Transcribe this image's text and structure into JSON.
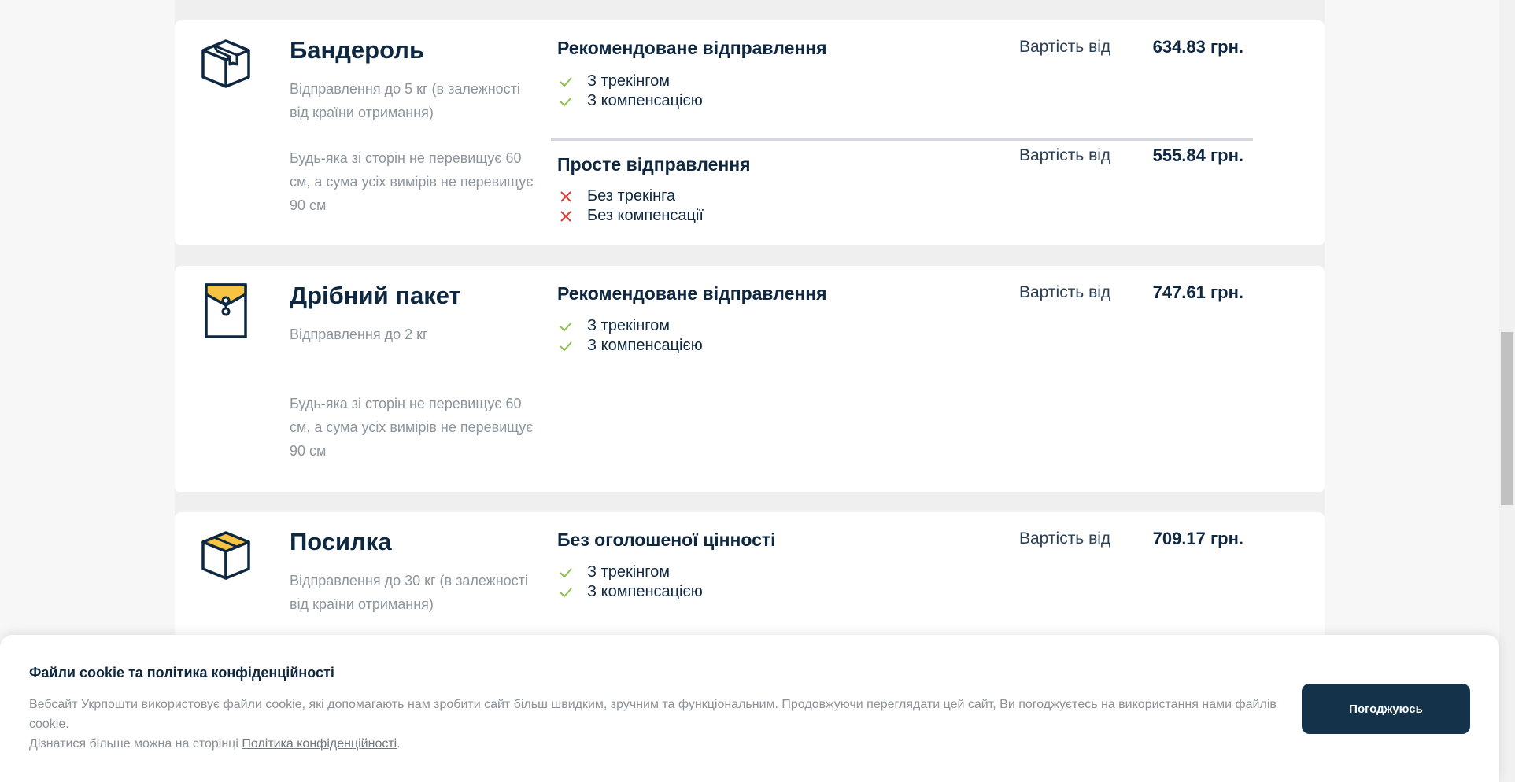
{
  "colors": {
    "brand_dark": "#0f2841",
    "accent_yellow": "#f6c343",
    "check_green": "#8bc34a",
    "cross_red": "#e53935",
    "button_bg": "#143249"
  },
  "cards": [
    {
      "icon": "box-icon",
      "title": "Бандероль",
      "desc1": "Відправлення до 5 кг (в залежності від країни отримання)",
      "desc2": "Будь-яка зі сторін не перевищує 60 см, а сума усіх вимірів не перевищує 90 см",
      "options": [
        {
          "title": "Рекомендоване відправлення",
          "features": [
            {
              "icon": "check-icon",
              "text": "З трекінгом"
            },
            {
              "icon": "check-icon",
              "text": "З компенсацією"
            }
          ],
          "price_label": "Вартість від",
          "price": "634.83 грн."
        },
        {
          "title": "Просте відправлення",
          "features": [
            {
              "icon": "cross-icon",
              "text": "Без трекінга"
            },
            {
              "icon": "cross-icon",
              "text": "Без компенсації"
            }
          ],
          "price_label": "Вартість від",
          "price": "555.84 грн."
        }
      ]
    },
    {
      "icon": "envelope-icon",
      "title": "Дрібний пакет",
      "desc1": "Відправлення до 2 кг",
      "desc2": "Будь-яка зі сторін не перевищує 60 см, а сума усіх вимірів не перевищує 90 см",
      "options": [
        {
          "title": "Рекомендоване відправлення",
          "features": [
            {
              "icon": "check-icon",
              "text": "З трекінгом"
            },
            {
              "icon": "check-icon",
              "text": "З компенсацією"
            }
          ],
          "price_label": "Вартість від",
          "price": "747.61 грн."
        }
      ]
    },
    {
      "icon": "parcel-box-icon",
      "title": "Посилка",
      "desc1": "Відправлення до 30 кг (в залежності від країни отримання)",
      "options": [
        {
          "title": "Без оголошеної цінності",
          "features": [
            {
              "icon": "check-icon",
              "text": "З трекінгом"
            },
            {
              "icon": "check-icon",
              "text": "З компенсацією"
            }
          ],
          "price_label": "Вартість від",
          "price": "709.17 грн."
        }
      ]
    }
  ],
  "cookie": {
    "title": "Файли cookie та політика конфіденційності",
    "text": "Вебсайт Укрпошти використовує файли cookie, які допомагають нам зробити сайт більш швидким, зручним та функціональним. Продовжуючи переглядати цей сайт, Ви погоджуєтесь на використання нами файлів cookie.",
    "more_prefix": "Дізнатися більше можна на сторінці ",
    "link_text": "Політика конфіденційності",
    "more_suffix": ".",
    "button": "Погоджуюсь"
  }
}
